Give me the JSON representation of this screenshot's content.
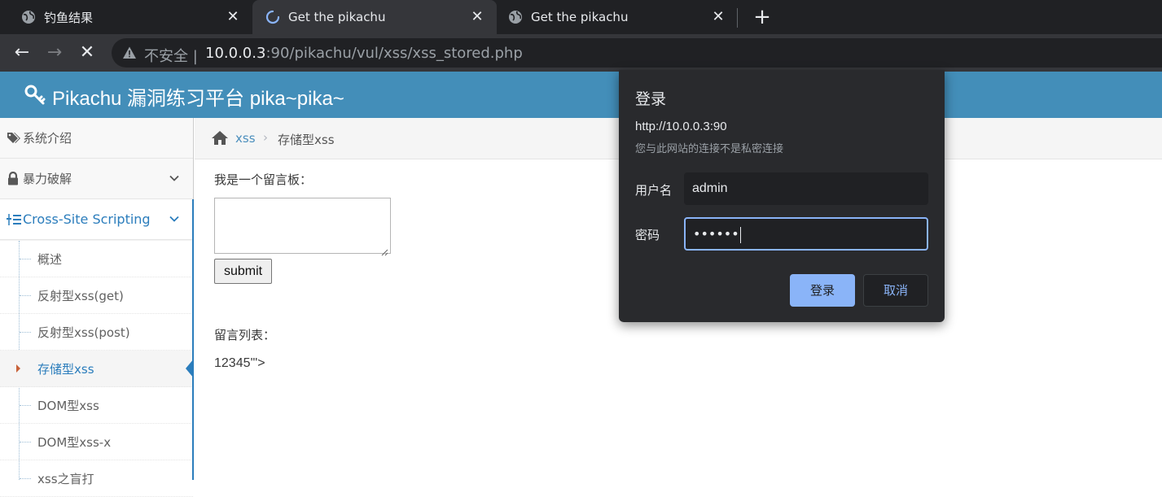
{
  "browser": {
    "tabs": [
      {
        "title": "钓鱼结果",
        "icon": "globe-icon",
        "active": false
      },
      {
        "title": "Get the pikachu",
        "icon": "loading-spinner-icon",
        "active": true
      },
      {
        "title": "Get the pikachu",
        "icon": "globe-icon",
        "active": false
      }
    ],
    "tab_close": "✕",
    "new_tab": "+",
    "nav": {
      "back": "←",
      "forward": "→",
      "stop": "✕"
    },
    "address": {
      "security_label": "不安全",
      "separator": "|",
      "host": "10.0.0.3",
      "rest": ":90/pikachu/vul/xss/xss_stored.php"
    }
  },
  "site": {
    "title": "Pikachu 漏洞练习平台 pika~pika~",
    "accent": "#438eb9"
  },
  "sidebar": {
    "items": [
      {
        "label": "系统介绍",
        "icon": "tags-icon"
      },
      {
        "label": "暴力破解",
        "icon": "lock-icon",
        "expandable": true
      },
      {
        "label": "Cross-Site Scripting",
        "icon": "list-icon",
        "expandable": true,
        "active": true
      }
    ],
    "subitems": [
      {
        "label": "概述"
      },
      {
        "label": "反射型xss(get)"
      },
      {
        "label": "反射型xss(post)"
      },
      {
        "label": "存储型xss",
        "active": true
      },
      {
        "label": "DOM型xss"
      },
      {
        "label": "DOM型xss-x"
      },
      {
        "label": "xss之盲打"
      }
    ]
  },
  "breadcrumb": {
    "link": "xss",
    "separator": "›",
    "current": "存储型xss"
  },
  "main": {
    "board_label": "我是一个留言板：",
    "textarea_value": "",
    "submit_label": "submit",
    "list_label": "留言列表：",
    "messages": [
      "12345'\">"
    ]
  },
  "auth_dialog": {
    "title": "登录",
    "origin": "http://10.0.0.3:90",
    "subtitle": "您与此网站的连接不是私密连接",
    "username_label": "用户名",
    "username_value": "admin",
    "password_label": "密码",
    "password_mask": "••••••",
    "login_label": "登录",
    "cancel_label": "取消",
    "accent": "#8ab4f8"
  }
}
